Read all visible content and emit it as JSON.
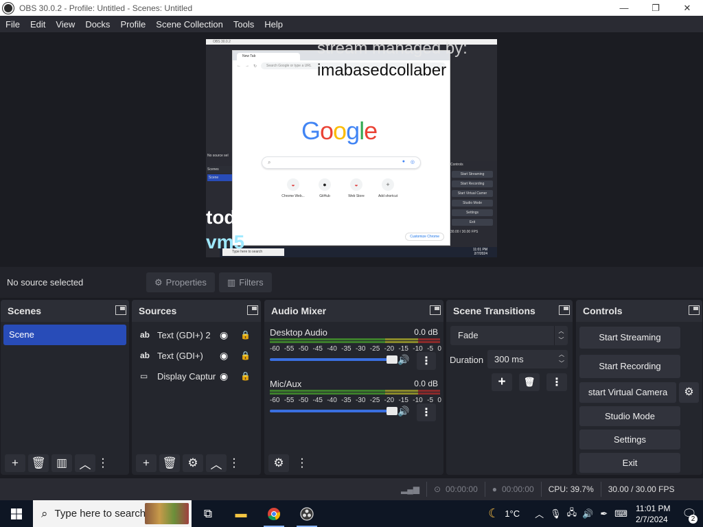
{
  "window": {
    "title": "OBS 30.0.2 - Profile: Untitled - Scenes: Untitled",
    "minimize": "—",
    "maximize": "❐",
    "close": "✕"
  },
  "menu": [
    "File",
    "Edit",
    "View",
    "Docks",
    "Profile",
    "Scene Collection",
    "Tools",
    "Help"
  ],
  "preview": {
    "overlay_line1": "stream managed by:",
    "overlay_line2": "imabasedcollaber",
    "overlay_line3": "today's vm:",
    "overlay_line4": "vm5",
    "browser_tab": "New Tab",
    "browser_omnibox": "Search Google or type a URL",
    "google_logo": "Google",
    "shortcuts": [
      {
        "label": "Chrome Web...",
        "icon": "◒"
      },
      {
        "label": "GitHub",
        "icon": "●"
      },
      {
        "label": "Web Store",
        "icon": "◒"
      },
      {
        "label": "Add shortcut",
        "icon": "+"
      }
    ],
    "customize": "Customize Chrome",
    "nested_search": "Type here to search",
    "nested_scenes": "Scenes",
    "nested_scene_item": "Scene",
    "nested_no_source": "No source sel",
    "nested_controls": "Controls",
    "nested_buttons": [
      "Start Streaming",
      "Start Recording",
      "Start Virtual Camer",
      "Studio Mode",
      "Settings",
      "Exit"
    ],
    "nested_fps": "30.00 / 30.00 FPS",
    "nested_time": "11:01 PM",
    "nested_date": "2/7/2024"
  },
  "source_toolbar": {
    "no_source": "No source selected",
    "properties": "Properties",
    "filters": "Filters"
  },
  "scenes": {
    "title": "Scenes",
    "items": [
      "Scene"
    ]
  },
  "sources": {
    "title": "Sources",
    "items": [
      {
        "type": "ab",
        "name": "Text (GDI+) 2"
      },
      {
        "type": "ab",
        "name": "Text (GDI+)"
      },
      {
        "type": "display",
        "name": "Display Captur"
      }
    ]
  },
  "audio_mixer": {
    "title": "Audio Mixer",
    "channels": [
      {
        "name": "Desktop Audio",
        "level": "0.0 dB",
        "volume": 1.0
      },
      {
        "name": "Mic/Aux",
        "level": "0.0 dB",
        "volume": 1.0
      }
    ],
    "scale": [
      "-60",
      "-55",
      "-50",
      "-45",
      "-40",
      "-35",
      "-30",
      "-25",
      "-20",
      "-15",
      "-10",
      "-5",
      "0"
    ]
  },
  "scene_transitions": {
    "title": "Scene Transitions",
    "transition": "Fade",
    "duration_label": "Duration",
    "duration_value": "300 ms"
  },
  "controls": {
    "title": "Controls",
    "start_streaming": "Start Streaming",
    "start_recording": "Start Recording",
    "start_virtual_camera": "start Virtual Camera",
    "studio_mode": "Studio Mode",
    "settings": "Settings",
    "exit": "Exit"
  },
  "status": {
    "stream_time": "00:00:00",
    "record_time": "00:00:00",
    "cpu": "CPU: 39.7%",
    "fps": "30.00 / 30.00 FPS"
  },
  "taskbar": {
    "search_placeholder": "Type here to search",
    "weather": "1°C",
    "time": "11:01 PM",
    "date": "2/7/2024",
    "notifications": "2"
  },
  "colors": {
    "accent": "#284cb8",
    "panel": "#24262d",
    "background": "#1b1c22"
  }
}
